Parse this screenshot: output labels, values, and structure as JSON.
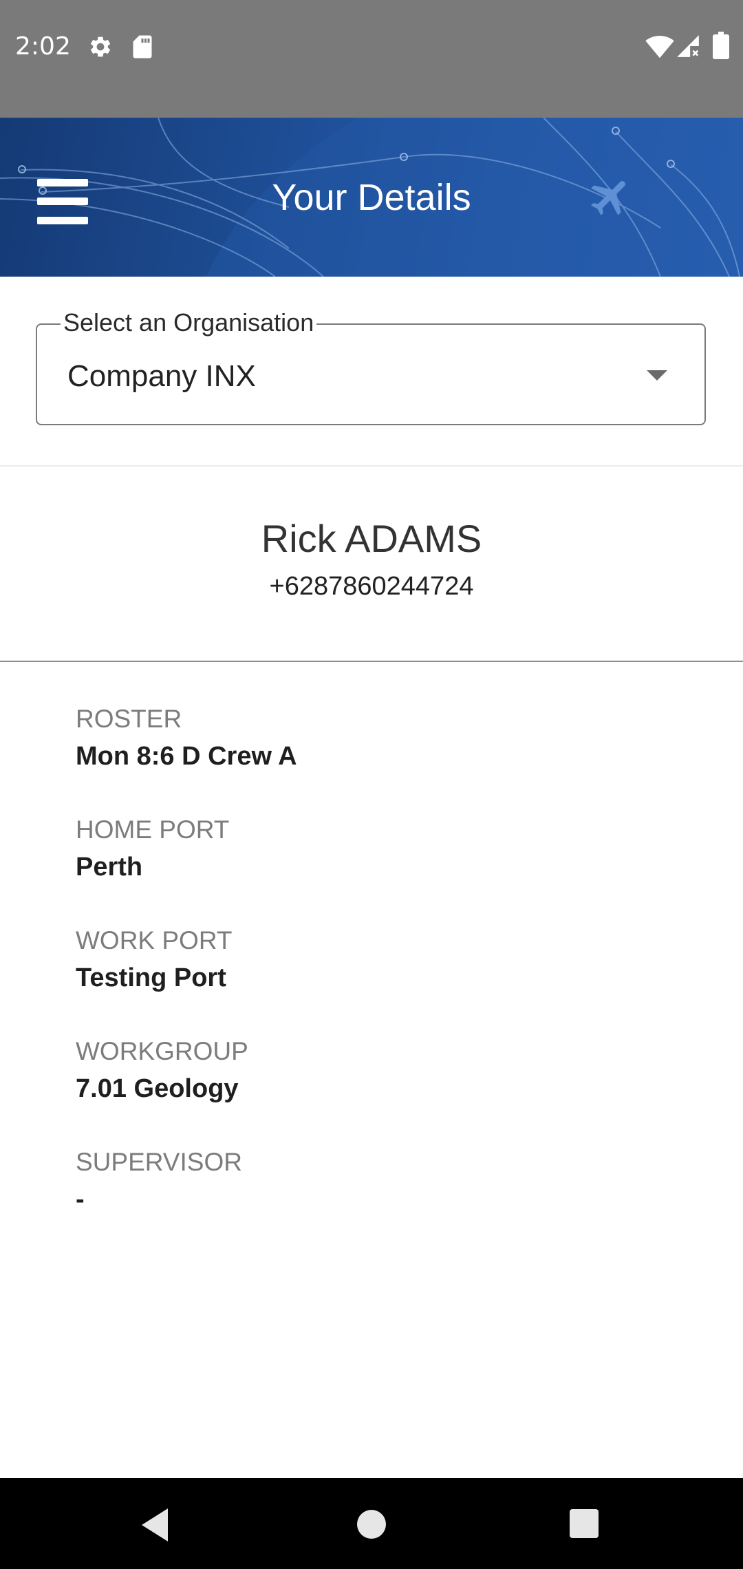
{
  "status_bar": {
    "time": "2:02",
    "icons": [
      "gear-icon",
      "sd-card-icon",
      "wifi-icon",
      "signal-icon",
      "battery-icon"
    ]
  },
  "header": {
    "title": "Your Details",
    "menu_icon": "hamburger-menu-icon",
    "decoration_icon": "airplane-icon",
    "gradient_colors": [
      "#153a75",
      "#2a62b4"
    ]
  },
  "organisation_select": {
    "label": "Select an Organisation",
    "value": "Company INX",
    "icon": "dropdown-arrow-icon"
  },
  "profile": {
    "name": "Rick ADAMS",
    "phone": "+6287860244724"
  },
  "details": [
    {
      "label": "ROSTER",
      "value": "Mon 8:6 D Crew A"
    },
    {
      "label": "HOME PORT",
      "value": "Perth"
    },
    {
      "label": "WORK PORT",
      "value": "Testing Port"
    },
    {
      "label": "WORKGROUP",
      "value": "7.01 Geology"
    },
    {
      "label": "SUPERVISOR",
      "value": "-"
    }
  ],
  "nav_bar": {
    "icons": [
      "back-icon",
      "home-icon",
      "recents-icon"
    ]
  }
}
